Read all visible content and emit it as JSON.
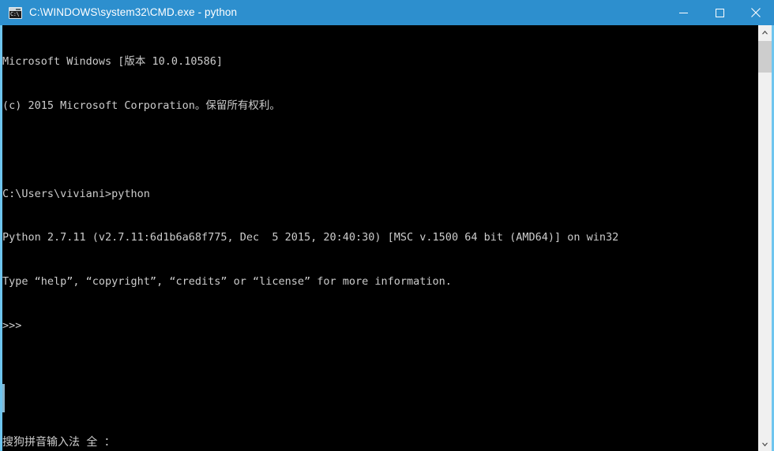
{
  "window": {
    "title": "C:\\WINDOWS\\system32\\CMD.exe - python",
    "icon": "cmd-prompt-icon",
    "icon_text": "C:\\",
    "titlebar_color": "#2d8fce",
    "border_color": "#6ec5ef",
    "background_color": "#000000",
    "text_color": "#cccccc"
  },
  "titlebar_buttons": {
    "minimize": "minimize-icon",
    "maximize": "maximize-icon",
    "close": "close-icon"
  },
  "console": {
    "lines": [
      "Microsoft Windows [版本 10.0.10586]",
      "(c) 2015 Microsoft Corporation。保留所有权利。",
      "",
      "C:\\Users\\viviani>python",
      "Python 2.7.11 (v2.7.11:6d1b6a68f775, Dec  5 2015, 20:40:30) [MSC v.1500 64 bit (AMD64)] on win32",
      "Type “help”, “copyright”, “credits” or “license” for more information.",
      ">>>"
    ]
  },
  "ime": {
    "status": "搜狗拼音输入法 全 ："
  },
  "scrollbar": {
    "up_arrow": "scroll-up-arrow-icon",
    "down_arrow": "scroll-down-arrow-icon",
    "thumb": "scrollbar-thumb",
    "track_color": "#f0f0f0",
    "thumb_color": "#cdcdcd"
  }
}
